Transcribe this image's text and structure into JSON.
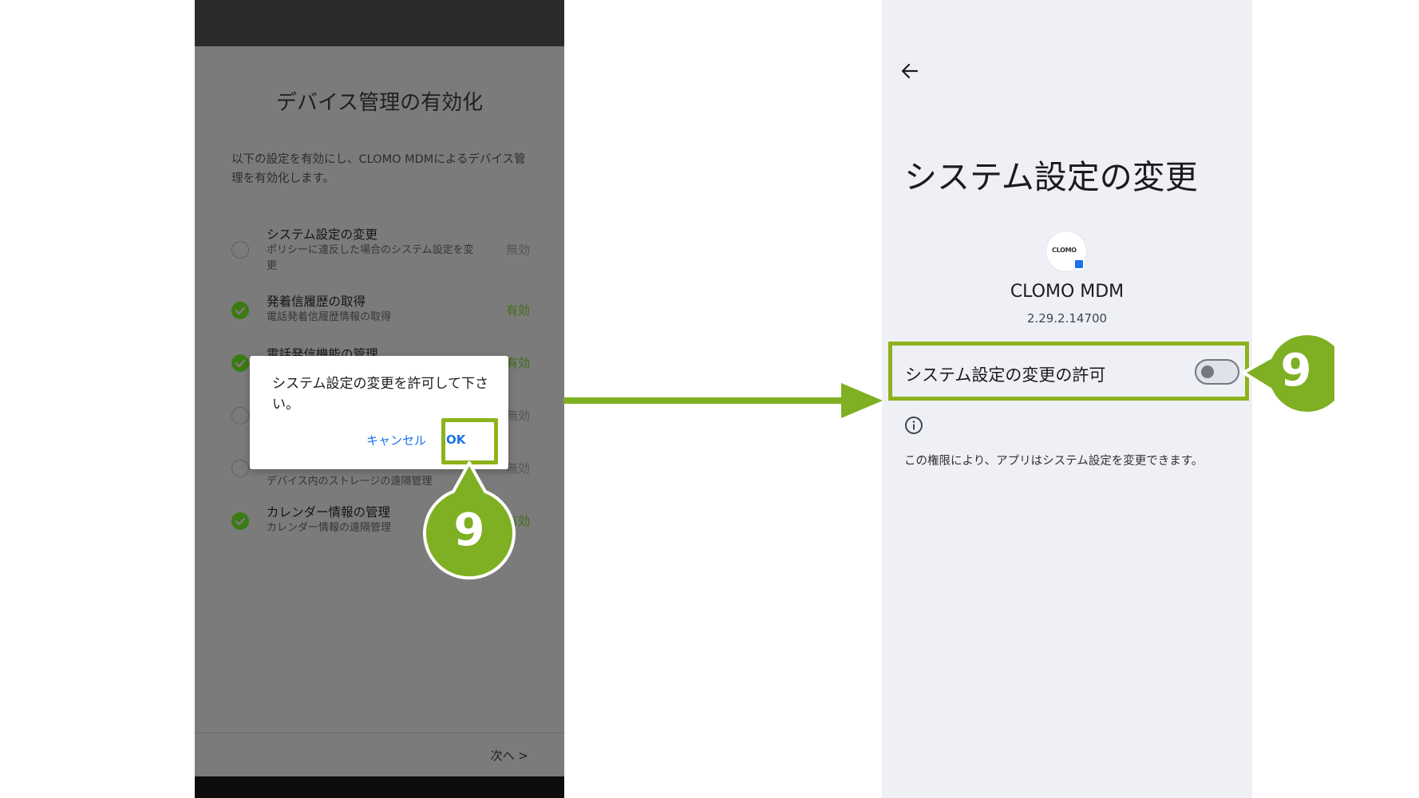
{
  "left_screen": {
    "title": "デバイス管理の有効化",
    "description": "以下の設定を有効にし、CLOMO MDMによるデバイス管理を有効化します。",
    "permissions": [
      {
        "title": "システム設定の変更",
        "subtitle": "ポリシーに違反した場合のシステム設定を変更",
        "status": "無効",
        "enabled": false
      },
      {
        "title": "発着信履歴の取得",
        "subtitle": "電話発着信履歴情報の取得",
        "status": "有効",
        "enabled": true
      },
      {
        "title": "電話発信機能の管理",
        "subtitle": "",
        "status": "有効",
        "enabled": true
      },
      {
        "title": "",
        "subtitle": "",
        "status": "無効",
        "enabled": false
      },
      {
        "title": "",
        "subtitle": "デバイス内のストレージの遠隔管理",
        "status": "無効",
        "enabled": false
      },
      {
        "title": "カレンダー情報の管理",
        "subtitle": "カレンダー情報の遠隔管理",
        "status": "有効",
        "enabled": true
      }
    ],
    "next_label": "次へ >",
    "dialog": {
      "message": "システム設定の変更を許可して下さい。",
      "cancel_label": "キャンセル",
      "ok_label": "OK"
    }
  },
  "right_screen": {
    "page_title": "システム設定の変更",
    "app_logo_text": "CLOMO",
    "app_name": "CLOMO MDM",
    "app_version": "2.29.2.14700",
    "toggle_label": "システム設定の変更の許可",
    "toggle_on": false,
    "info_text": "この権限により、アプリはシステム設定を変更できます。"
  },
  "annotations": {
    "step_number": "9",
    "highlight_color": "#8db31b",
    "callout_color": "#7faf22"
  }
}
